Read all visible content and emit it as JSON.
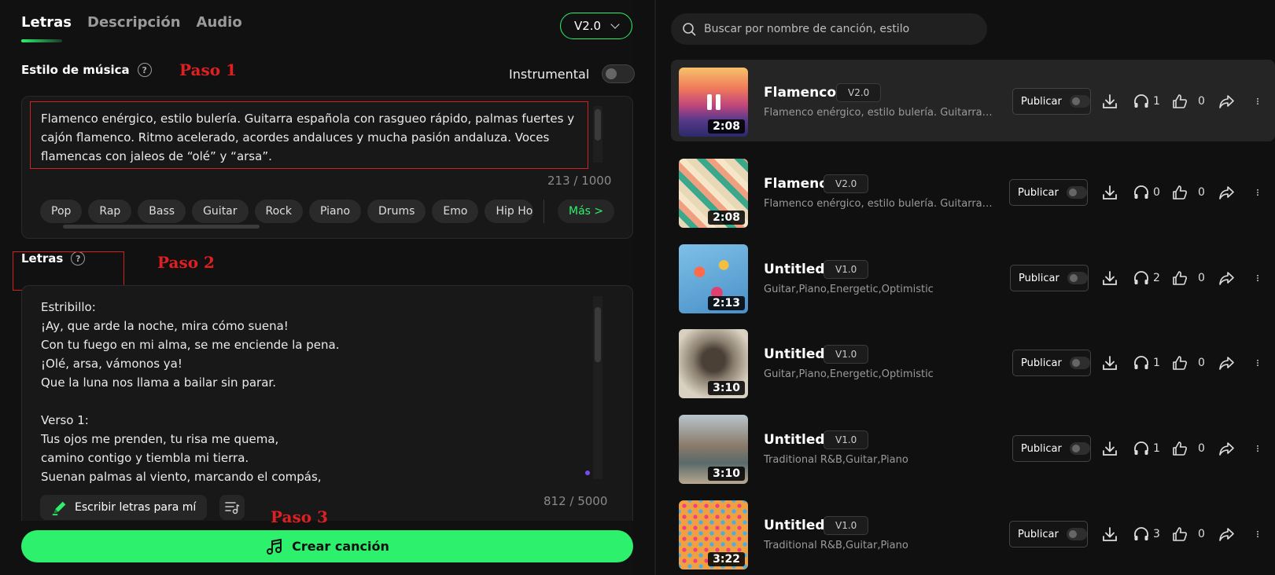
{
  "tabs": [
    "Letras",
    "Descripción",
    "Audio"
  ],
  "version_select": "V2.0",
  "style_section": {
    "label": "Estilo de música",
    "paso": "Paso 1",
    "instrumental_label": "Instrumental",
    "text": "Flamenco enérgico, estilo bulería. Guitarra española con rasgueo rápido, palmas fuertes y cajón flamenco. Ritmo acelerado, acordes andaluces y mucha pasión andaluza. Voces flamencas con jaleos de “olé” y “arsa”.",
    "counter": "213 / 1000",
    "chips": [
      "Pop",
      "Rap",
      "Bass",
      "Guitar",
      "Rock",
      "Piano",
      "Drums",
      "Emo",
      "Hip Ho"
    ],
    "more_label": "Más >"
  },
  "lyrics_section": {
    "label": "Letras",
    "paso": "Paso 2",
    "text": "Estribillo:\n¡Ay, que arde la noche, mira cómo suena!\nCon tu fuego en mi alma, se me enciende la pena.\n¡Olé, arsa, vámonos ya!\nQue la luna nos llama a bailar sin parar.\n\nVerso 1:\nTus ojos me prenden, tu risa me quema,\ncamino contigo y tiembla mi tierra.\nSuenan palmas al viento, marcando el compás,",
    "write_button": "Escribir letras para mí",
    "counter": "812 / 5000"
  },
  "create": {
    "paso": "Paso 3",
    "label": "Crear canción"
  },
  "search": {
    "placeholder": "Buscar por nombre de canción, estilo"
  },
  "songs": [
    {
      "title": "Flamenco",
      "version": "V2.0",
      "desc": "Flamenco enérgico, estilo bulería. Guitarra española con rasgueo rápido",
      "duration": "2:08",
      "publish": "Publicar",
      "listens": "1",
      "likes": "0",
      "playing": true
    },
    {
      "title": "Flamenco",
      "version": "V2.0",
      "desc": "Flamenco enérgico, estilo bulería. Guitarra española con rasgueo rápido",
      "duration": "2:08",
      "publish": "Publicar",
      "listens": "0",
      "likes": "0"
    },
    {
      "title": "Untitled",
      "version": "V1.0",
      "desc": "Guitar,Piano,Energetic,Optimistic",
      "duration": "2:13",
      "publish": "Publicar",
      "listens": "2",
      "likes": "0"
    },
    {
      "title": "Untitled",
      "version": "V1.0",
      "desc": "Guitar,Piano,Energetic,Optimistic",
      "duration": "3:10",
      "publish": "Publicar",
      "listens": "1",
      "likes": "0"
    },
    {
      "title": "Untitled",
      "version": "V1.0",
      "desc": "Traditional R&B,Guitar,Piano",
      "duration": "3:10",
      "publish": "Publicar",
      "listens": "1",
      "likes": "0"
    },
    {
      "title": "Untitled",
      "version": "V1.0",
      "desc": "Traditional R&B,Guitar,Piano",
      "duration": "3:22",
      "publish": "Publicar",
      "listens": "3",
      "likes": "0"
    }
  ],
  "colors": {
    "accent": "#2df06c",
    "annotation": "#e02020",
    "background": "#101010"
  }
}
